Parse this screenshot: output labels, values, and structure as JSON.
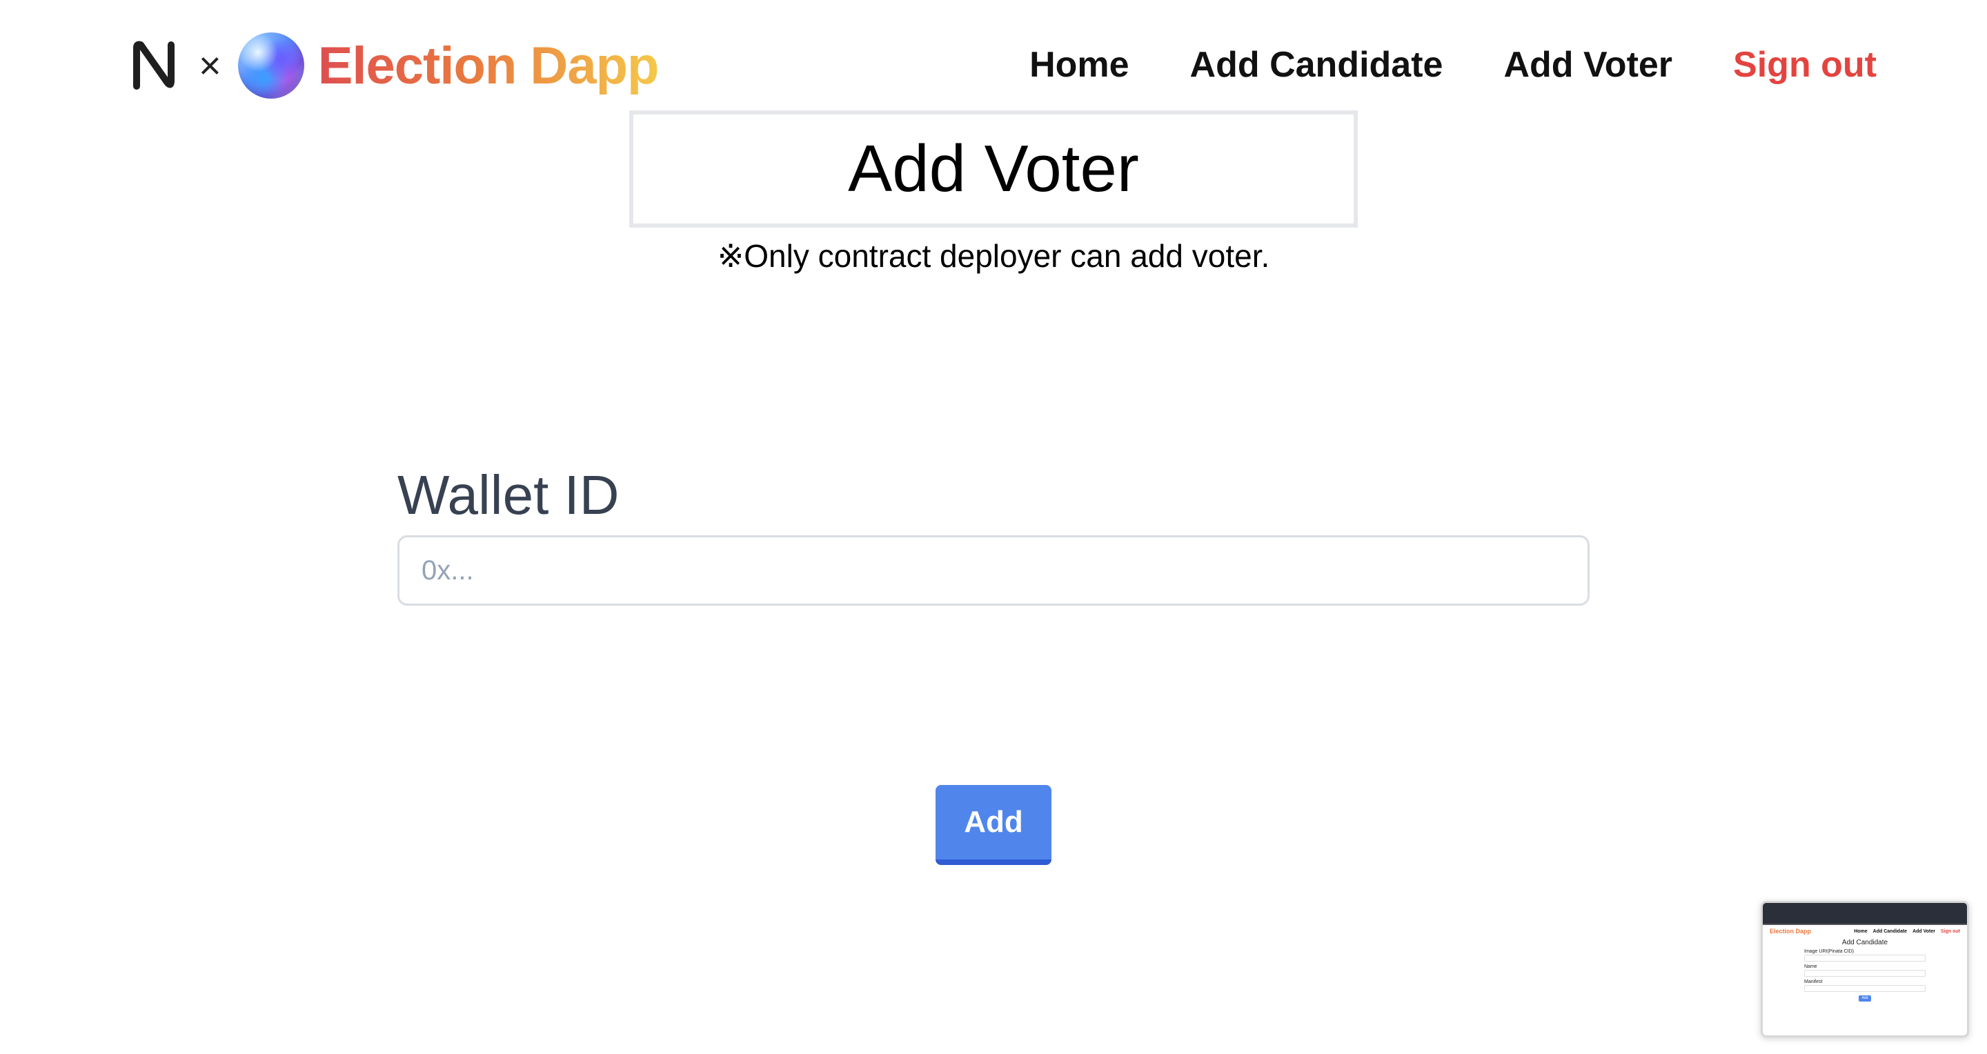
{
  "header": {
    "separator": "×",
    "brand_title": "Election Dapp",
    "nav": {
      "home": "Home",
      "add_candidate": "Add Candidate",
      "add_voter": "Add Voter",
      "sign_out": "Sign out"
    }
  },
  "main": {
    "title": "Add Voter",
    "note": "※Only contract deployer can add voter.",
    "wallet": {
      "label": "Wallet ID",
      "placeholder": "0x...",
      "value": ""
    },
    "add_button": "Add"
  },
  "thumbnail": {
    "brand_title": "Election Dapp",
    "nav": [
      "Home",
      "Add Candidate",
      "Add Voter",
      "Sign out"
    ],
    "title": "Add Candidate",
    "fields": [
      "Image URI(Pinata CID)",
      "Name",
      "Manifest"
    ],
    "button": "Add"
  },
  "colors": {
    "brand_gradient": [
      "#de4f4f",
      "#e9793f",
      "#f4c84a"
    ],
    "sign_out": "#e3443f",
    "primary_button": "#5086ec",
    "label": "#374151"
  },
  "icons": {
    "near": "near-logo-icon",
    "orb": "gradient-orb-icon"
  }
}
